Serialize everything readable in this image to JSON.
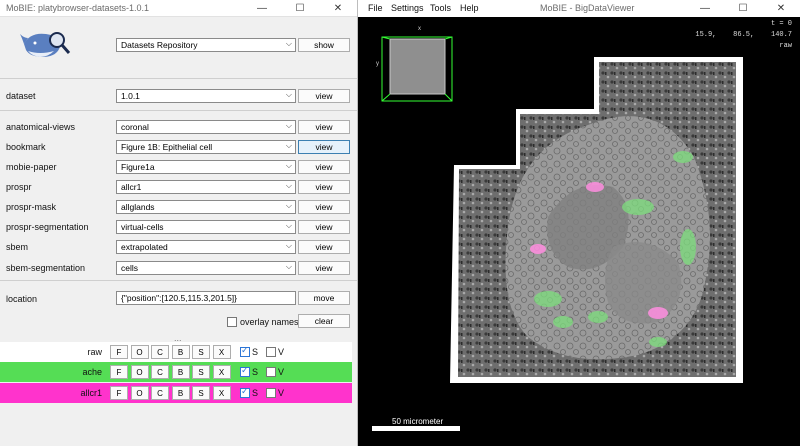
{
  "left_window": {
    "title": "MoBIE: platybrowser-datasets-1.0.1",
    "controls": {
      "minimize": "—",
      "maximize": "☐",
      "close": "✕"
    },
    "logo_icon": "whale-magnifier-logo",
    "repo": {
      "value": "Datasets Repository",
      "button": "show"
    },
    "dataset": {
      "label": "dataset",
      "value": "1.0.1",
      "button": "view"
    },
    "sources": [
      {
        "label": "anatomical-views",
        "value": "coronal",
        "button": "view"
      },
      {
        "label": "bookmark",
        "value": "Figure 1B: Epithelial cell",
        "button": "view"
      },
      {
        "label": "mobie-paper",
        "value": "Figure1a",
        "button": "view"
      },
      {
        "label": "prospr",
        "value": "allcr1",
        "button": "view"
      },
      {
        "label": "prospr-mask",
        "value": "allglands",
        "button": "view"
      },
      {
        "label": "prospr-segmentation",
        "value": "virtual-cells",
        "button": "view"
      },
      {
        "label": "sbem",
        "value": "extrapolated",
        "button": "view"
      },
      {
        "label": "sbem-segmentation",
        "value": "cells",
        "button": "view"
      }
    ],
    "location": {
      "label": "location",
      "value": "{\"position\":[120.5,115.3,201.5]}",
      "button": "move"
    },
    "overlay": {
      "label": "overlay names",
      "checked": false,
      "clear_button": "clear"
    },
    "splitter": "...",
    "layers": [
      {
        "name": "raw",
        "bg": "#ffffff",
        "buttons": [
          "F",
          "O",
          "C",
          "B",
          "S",
          "X"
        ],
        "s_label": "S",
        "s_checked": true,
        "v_label": "V",
        "v_checked": false
      },
      {
        "name": "ache",
        "bg": "#55dd55",
        "buttons": [
          "F",
          "O",
          "C",
          "B",
          "S",
          "X"
        ],
        "s_label": "S",
        "s_checked": true,
        "v_label": "V",
        "v_checked": false
      },
      {
        "name": "allcr1",
        "bg": "#ff33cc",
        "buttons": [
          "F",
          "O",
          "C",
          "B",
          "S",
          "X"
        ],
        "s_label": "S",
        "s_checked": true,
        "v_label": "V",
        "v_checked": false
      }
    ]
  },
  "right_window": {
    "title": "MoBIE - BigDataViewer",
    "menus": [
      "File",
      "Settings",
      "Tools",
      "Help"
    ],
    "controls": {
      "minimize": "—",
      "maximize": "☐",
      "close": "✕"
    },
    "overlay_text": {
      "time": "t = 0",
      "coords": "15.9,    86.5,    140.7",
      "mode": "raw"
    },
    "nav_box_axes": {
      "x": "x",
      "y": "y"
    },
    "scale_bar": "50 micrometer"
  }
}
